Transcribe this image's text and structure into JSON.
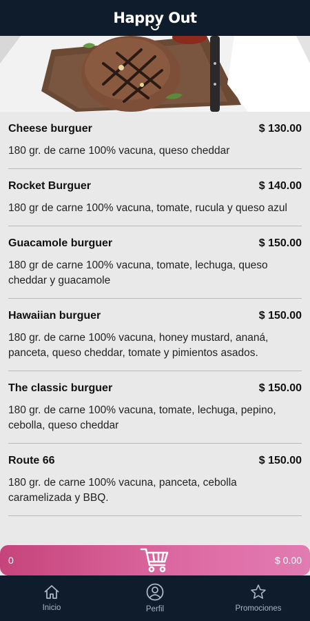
{
  "app": {
    "title": "Happy Out"
  },
  "menu": {
    "items": [
      {
        "name": "Cheese burguer",
        "price": "$ 130.00",
        "description": "180 gr. de carne 100% vacuna, queso cheddar"
      },
      {
        "name": "Rocket Burguer",
        "price": "$ 140.00",
        "description": "180 gr de carne 100% vacuna, tomate, rucula y queso azul"
      },
      {
        "name": "Guacamole burguer",
        "price": "$ 150.00",
        "description": "180 gr de carne 100% vacuna, tomate, lechuga, queso cheddar y guacamole"
      },
      {
        "name": "Hawaiian burguer",
        "price": "$ 150.00",
        "description": "180 gr. de carne 100% vacuna, honey mustard, ananá, panceta, queso cheddar, tomate y pimientos asados."
      },
      {
        "name": "The classic burguer",
        "price": "$ 150.00",
        "description": "180 gr. de carne 100% vacuna, tomate, lechuga, pepino, cebolla, queso cheddar"
      },
      {
        "name": "Route 66",
        "price": "$ 150.00",
        "description": "180 gr. de carne 100% vacuna, panceta, cebolla caramelizada y BBQ."
      }
    ]
  },
  "cart": {
    "count": "0",
    "total": "$ 0.00",
    "icon": "cart-icon"
  },
  "nav": {
    "home": {
      "label": "Inicio",
      "icon": "home-icon"
    },
    "profile": {
      "label": "Perfil",
      "icon": "user-icon"
    },
    "promos": {
      "label": "Promociones",
      "icon": "star-icon"
    }
  },
  "colors": {
    "header_bg": "#0e1c2c",
    "cart_gradient_start": "#c5447b",
    "cart_gradient_end": "#e07cb1",
    "background": "#e9e9e9"
  }
}
